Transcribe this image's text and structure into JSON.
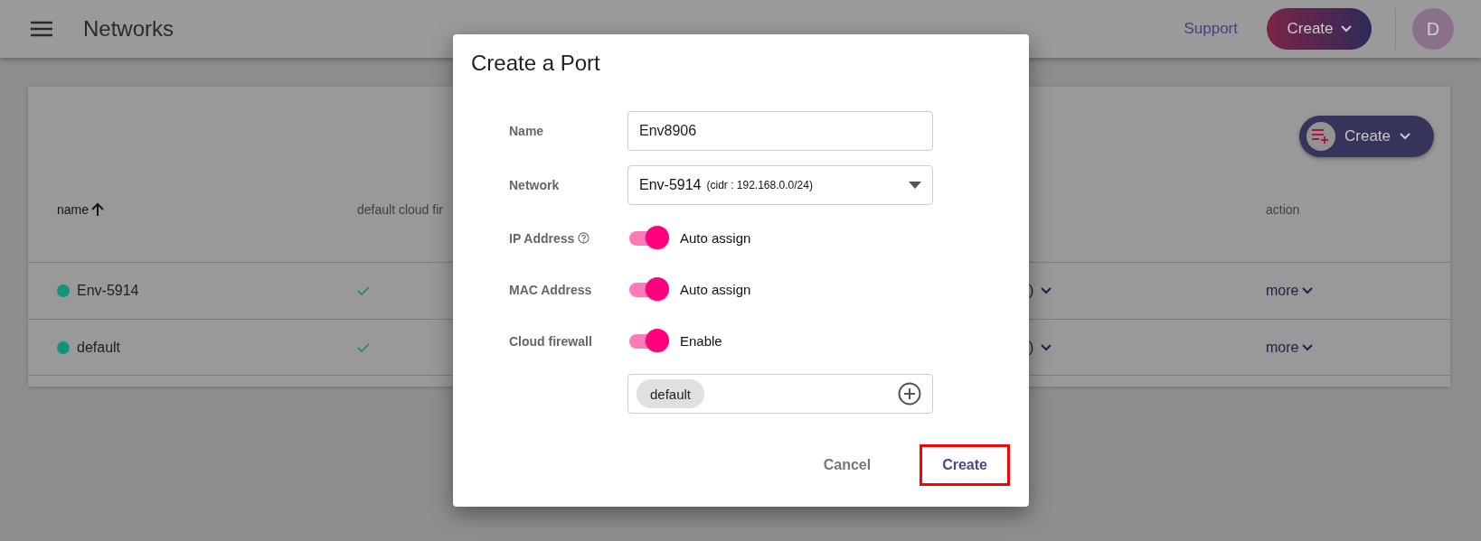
{
  "header": {
    "title": "Networks",
    "support_link": "Support",
    "create_button": "Create",
    "avatar": "D"
  },
  "card": {
    "create_button": "Create",
    "columns": [
      {
        "label": "name",
        "sorted": true
      },
      {
        "label": "default cloud fir",
        "sorted": false
      },
      {
        "label": "action",
        "sorted": false
      }
    ],
    "rows": [
      {
        "name": "Env-5914",
        "color": "#12937a",
        "default_firewall": true,
        "column_3": ")",
        "action": "more"
      },
      {
        "name": "default",
        "color": "#12937a",
        "default_firewall": true,
        "column_3": ")",
        "action": "more"
      }
    ]
  },
  "dialog": {
    "title": "Create a Port",
    "name": {
      "label": "Name",
      "value": "Env8906"
    },
    "network": {
      "label": "Network",
      "value": "Env-5914",
      "note": "(cidr : 192.168.0.0/24)"
    },
    "toggles": [
      {
        "label": "IP Address",
        "help": true,
        "on": true,
        "text": "Auto assign"
      },
      {
        "label": "MAC Address",
        "help": false,
        "on": true,
        "text": "Auto assign"
      },
      {
        "label": "Cloud firewall",
        "help": false,
        "on": true,
        "text": "Enable"
      }
    ],
    "firewall_tags": [
      {
        "label": "default"
      }
    ],
    "buttons": [
      {
        "label": "Cancel",
        "kind": "text",
        "highlighted": false
      },
      {
        "label": "Create",
        "kind": "primary",
        "highlighted": true
      }
    ]
  }
}
